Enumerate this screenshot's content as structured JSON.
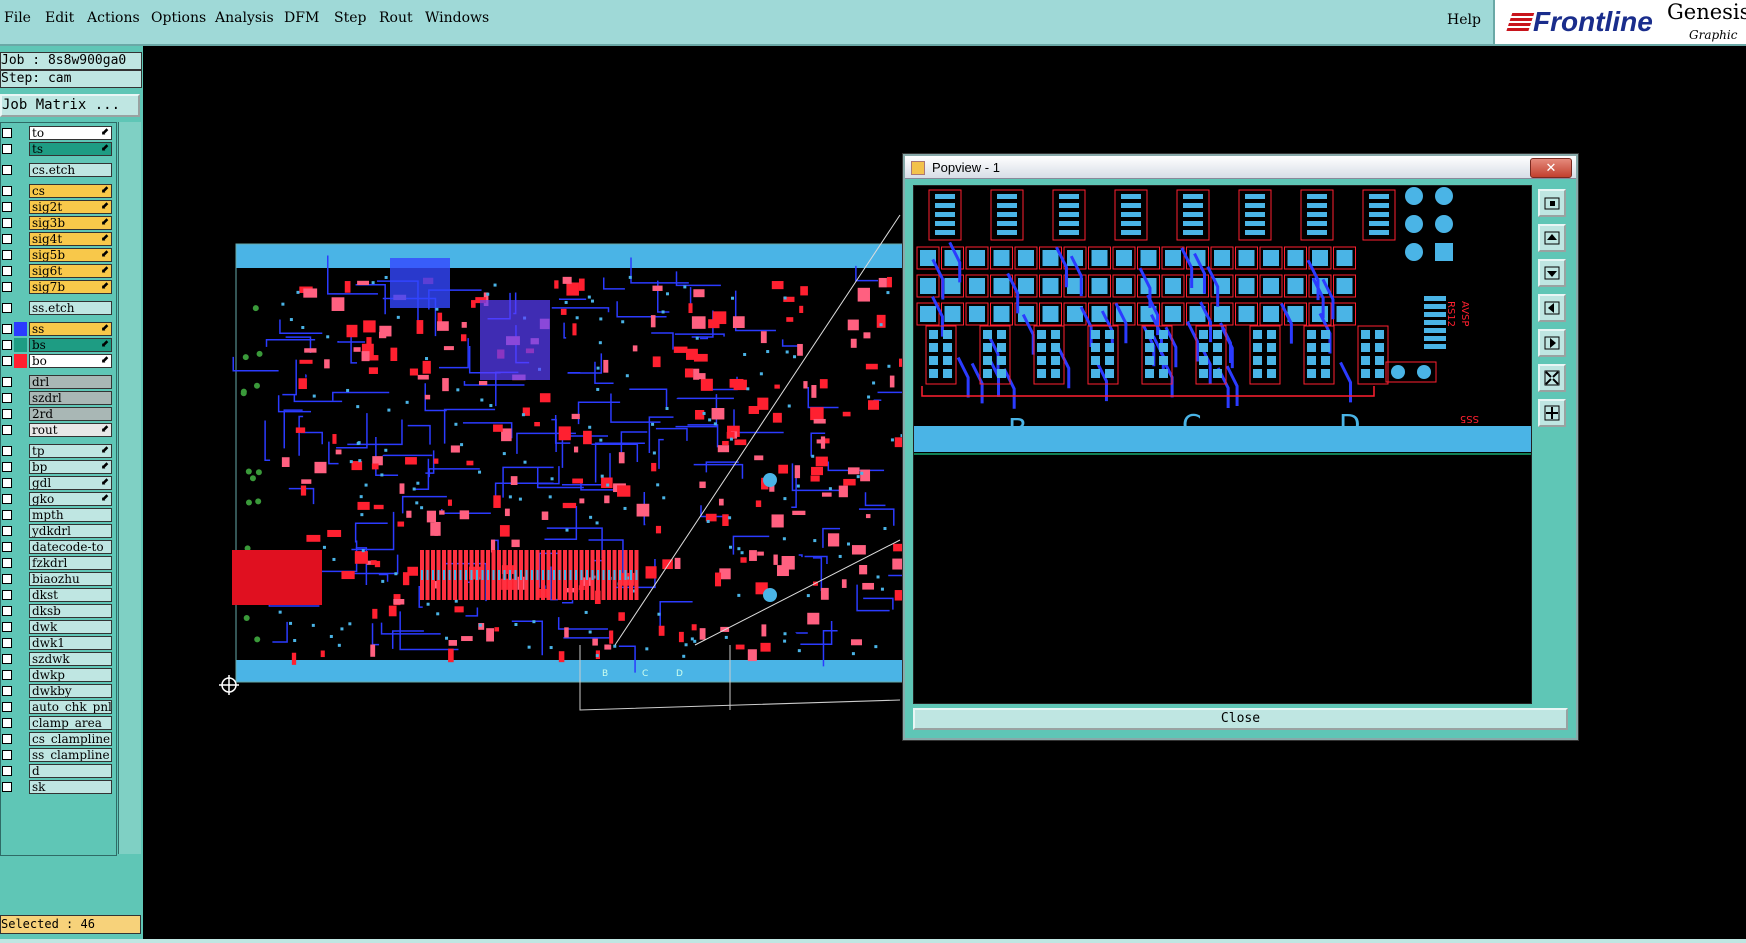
{
  "menu": {
    "items": [
      "File",
      "Edit",
      "Actions",
      "Options",
      "Analysis",
      "DFM",
      "Step",
      "Rout",
      "Windows"
    ],
    "help": "Help"
  },
  "brand": {
    "logo": "Frontline",
    "product": "Genesis",
    "subtitle": "Graphic E"
  },
  "info": {
    "job": "Job : 8s8w900ga0",
    "step": "Step: cam",
    "job_matrix": "Job Matrix ..."
  },
  "layers": [
    {
      "name": "to",
      "color": "#ffffff",
      "arrow": "⬋"
    },
    {
      "name": "ts",
      "color": "#1e9c83",
      "arrow": "⬋"
    },
    {
      "name": "cs.etch",
      "color": "#bfe6e2",
      "arrow": ""
    },
    {
      "name": "cs",
      "color": "#f8c84a",
      "arrow": "⬋"
    },
    {
      "name": "sig2t",
      "color": "#f8c84a",
      "arrow": "⬋"
    },
    {
      "name": "sig3b",
      "color": "#f8c84a",
      "arrow": "⬋"
    },
    {
      "name": "sig4t",
      "color": "#f8c84a",
      "arrow": "⬋"
    },
    {
      "name": "sig5b",
      "color": "#f8c84a",
      "arrow": "⬋"
    },
    {
      "name": "sig6t",
      "color": "#f8c84a",
      "arrow": "⬋"
    },
    {
      "name": "sig7b",
      "color": "#f8c84a",
      "arrow": "⬋"
    },
    {
      "name": "ss.etch",
      "color": "#bfe6e2",
      "arrow": ""
    },
    {
      "name": "ss",
      "color": "#f8c84a",
      "arrow": "⬋"
    },
    {
      "name": "bs",
      "color": "#1e9c83",
      "arrow": "⬋"
    },
    {
      "name": "bo",
      "color": "#ffffff",
      "arrow": "⬋"
    },
    {
      "name": "drl",
      "color": "#a9b7b5",
      "arrow": ""
    },
    {
      "name": "szdrl",
      "color": "#a9b7b5",
      "arrow": ""
    },
    {
      "name": "2rd",
      "color": "#a9b7b5",
      "arrow": ""
    },
    {
      "name": "rout",
      "color": "#e8e8e8",
      "arrow": "⬋"
    },
    {
      "name": "tp",
      "color": "#bfe6e2",
      "arrow": "⬋"
    },
    {
      "name": "bp",
      "color": "#bfe6e2",
      "arrow": "⬋"
    },
    {
      "name": "gdl",
      "color": "#bfe6e2",
      "arrow": "⬋"
    },
    {
      "name": "gko",
      "color": "#bfe6e2",
      "arrow": "⬋"
    },
    {
      "name": "mpth",
      "color": "#bfe6e2",
      "arrow": ""
    },
    {
      "name": "ydkdrl",
      "color": "#bfe6e2",
      "arrow": ""
    },
    {
      "name": "datecode-to",
      "color": "#bfe6e2",
      "arrow": ""
    },
    {
      "name": "fzkdrl",
      "color": "#bfe6e2",
      "arrow": ""
    },
    {
      "name": "biaozhu",
      "color": "#bfe6e2",
      "arrow": ""
    },
    {
      "name": "dkst",
      "color": "#bfe6e2",
      "arrow": ""
    },
    {
      "name": "dksb",
      "color": "#bfe6e2",
      "arrow": ""
    },
    {
      "name": "dwk",
      "color": "#bfe6e2",
      "arrow": ""
    },
    {
      "name": "dwk1",
      "color": "#bfe6e2",
      "arrow": ""
    },
    {
      "name": "szdwk",
      "color": "#bfe6e2",
      "arrow": ""
    },
    {
      "name": "dwkp",
      "color": "#bfe6e2",
      "arrow": ""
    },
    {
      "name": "dwkby",
      "color": "#bfe6e2",
      "arrow": ""
    },
    {
      "name": "auto_chk_pnl",
      "color": "#bfe6e2",
      "arrow": ""
    },
    {
      "name": "clamp_area",
      "color": "#bfe6e2",
      "arrow": ""
    },
    {
      "name": "cs_clampline",
      "color": "#bfe6e2",
      "arrow": ""
    },
    {
      "name": "ss_clampline",
      "color": "#bfe6e2",
      "arrow": ""
    },
    {
      "name": "d",
      "color": "#bfe6e2",
      "arrow": ""
    },
    {
      "name": "sk",
      "color": "#bfe6e2",
      "arrow": ""
    }
  ],
  "status": {
    "selected": "Selected : 46"
  },
  "popview": {
    "title": "Popview - 1",
    "close_x": "✕",
    "close_label": "Close",
    "labels": [
      "B",
      "C",
      "D"
    ],
    "rotated_labels": [
      "RS12",
      "AVSP",
      "SS5"
    ]
  },
  "board_labels": [
    "B",
    "C",
    "D"
  ],
  "colors": {
    "panel": "#5fc6b6",
    "menubar": "#9fd9d7",
    "trace_blue": "#2b3bff",
    "pad_cyan": "#4ab4e6",
    "outline_red": "#ff2030"
  }
}
